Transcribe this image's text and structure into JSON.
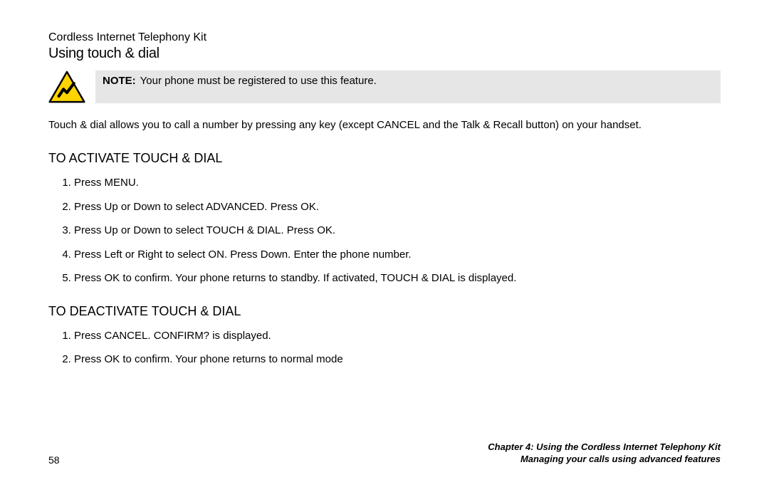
{
  "header": {
    "kicker": "Cordless Internet Telephony Kit",
    "title": "Using touch & dial"
  },
  "note": {
    "label": "NOTE:",
    "text": "Your phone must be registered to use this feature."
  },
  "intro": "Touch & dial allows you to call a number by pressing any key (except CANCEL and the Talk & Recall button) on your handset.",
  "sections": [
    {
      "heading": "TO ACTIVATE TOUCH & DIAL",
      "steps": [
        "Press MENU.",
        "Press Up or Down to select ADVANCED. Press OK.",
        "Press Up or Down to select TOUCH & DIAL. Press OK.",
        "Press Left or Right to select ON. Press Down. Enter the phone number.",
        "Press OK to confirm. Your phone returns to standby. If activated, TOUCH & DIAL is displayed."
      ]
    },
    {
      "heading": "TO DEACTIVATE TOUCH & DIAL",
      "steps": [
        "Press CANCEL. CONFIRM? is displayed.",
        "Press OK to confirm. Your phone returns to normal mode"
      ]
    }
  ],
  "footer": {
    "page_number": "58",
    "chapter": "Chapter 4: Using the Cordless Internet Telephony Kit",
    "subtitle": "Managing your calls using advanced features"
  }
}
